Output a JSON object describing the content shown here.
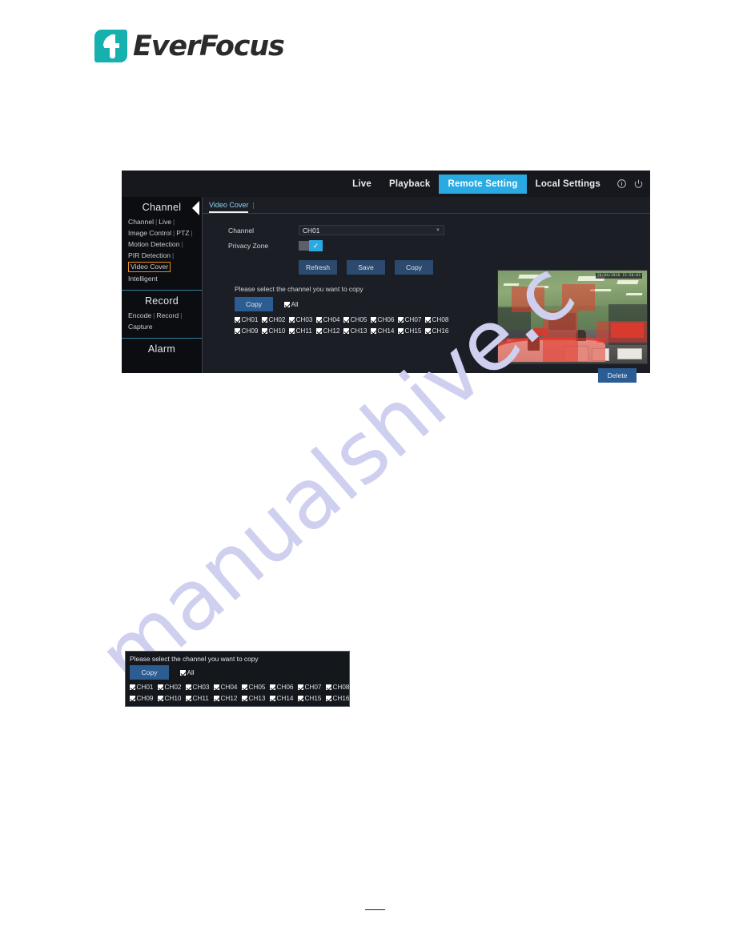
{
  "brand": {
    "name": "EverFocus",
    "logo_icon": "everfocus-f-logo-icon",
    "accent_color": "#16b0ae"
  },
  "watermark": {
    "text": "manualshive.c",
    "color": "#cfd0ef"
  },
  "app": {
    "topnav": {
      "items": [
        {
          "label": "Live",
          "active": false
        },
        {
          "label": "Playback",
          "active": false
        },
        {
          "label": "Remote Setting",
          "active": true
        },
        {
          "label": "Local Settings",
          "active": false
        }
      ],
      "active_color": "#2aaae2",
      "icons": [
        {
          "name": "info-icon",
          "glyph": "ⓘ"
        },
        {
          "name": "power-icon",
          "glyph": "⏻"
        }
      ]
    },
    "sidebar": {
      "groups": [
        {
          "title": "Channel",
          "lines": [
            [
              {
                "label": "Channel",
                "selected": false
              },
              {
                "label": "Live",
                "selected": false
              }
            ],
            [
              {
                "label": "Image Control",
                "selected": false
              },
              {
                "label": "PTZ",
                "selected": false
              }
            ],
            [
              {
                "label": "Motion Detection",
                "selected": false
              }
            ],
            [
              {
                "label": "PIR Detection",
                "selected": false
              }
            ],
            [
              {
                "label": "Video Cover",
                "selected": true
              }
            ],
            [
              {
                "label": "Intelligent",
                "selected": false
              }
            ]
          ]
        },
        {
          "title": "Record",
          "lines": [
            [
              {
                "label": "Encode",
                "selected": false
              },
              {
                "label": "Record",
                "selected": false
              }
            ],
            [
              {
                "label": "Capture",
                "selected": false
              }
            ]
          ]
        },
        {
          "title": "Alarm",
          "lines": []
        }
      ],
      "highlight_color": "#e98c1d",
      "collapse_icon": "collapse-left-arrow-icon"
    },
    "tabs": [
      {
        "label": "Video Cover",
        "active": true
      }
    ],
    "form": {
      "channel_label": "Channel",
      "channel_value": "CH01",
      "channel_options": [
        "CH01"
      ],
      "privacy_zone_label": "Privacy Zone",
      "privacy_zone_on": true,
      "toggle_check_glyph": "✓"
    },
    "buttons": {
      "refresh": "Refresh",
      "save": "Save",
      "copy": "Copy",
      "delete": "Delete"
    },
    "copy_panel": {
      "hint": "Please select the channel you want to copy",
      "copy_button": "Copy",
      "all_label": "All",
      "all_checked": true,
      "channels": [
        {
          "label": "CH01",
          "checked": true
        },
        {
          "label": "CH02",
          "checked": true
        },
        {
          "label": "CH03",
          "checked": true
        },
        {
          "label": "CH04",
          "checked": true
        },
        {
          "label": "CH05",
          "checked": true
        },
        {
          "label": "CH06",
          "checked": true
        },
        {
          "label": "CH07",
          "checked": true
        },
        {
          "label": "CH08",
          "checked": true
        },
        {
          "label": "CH09",
          "checked": true
        },
        {
          "label": "CH10",
          "checked": true
        },
        {
          "label": "CH11",
          "checked": true
        },
        {
          "label": "CH12",
          "checked": true
        },
        {
          "label": "CH13",
          "checked": true
        },
        {
          "label": "CH14",
          "checked": true
        },
        {
          "label": "CH15",
          "checked": true
        },
        {
          "label": "CH16",
          "checked": true
        }
      ]
    },
    "preview": {
      "timestamp": "20/06/2018 15:50:03",
      "scene": "retail-store-interior",
      "mask_color": "#e23a2e"
    }
  },
  "detail_figure": {
    "hint": "Please select the channel you want to copy",
    "copy_button": "Copy",
    "all_label": "All",
    "channels": [
      "CH01",
      "CH02",
      "CH03",
      "CH04",
      "CH05",
      "CH06",
      "CH07",
      "CH08",
      "CH09",
      "CH10",
      "CH11",
      "CH12",
      "CH13",
      "CH14",
      "CH15",
      "CH16"
    ]
  }
}
